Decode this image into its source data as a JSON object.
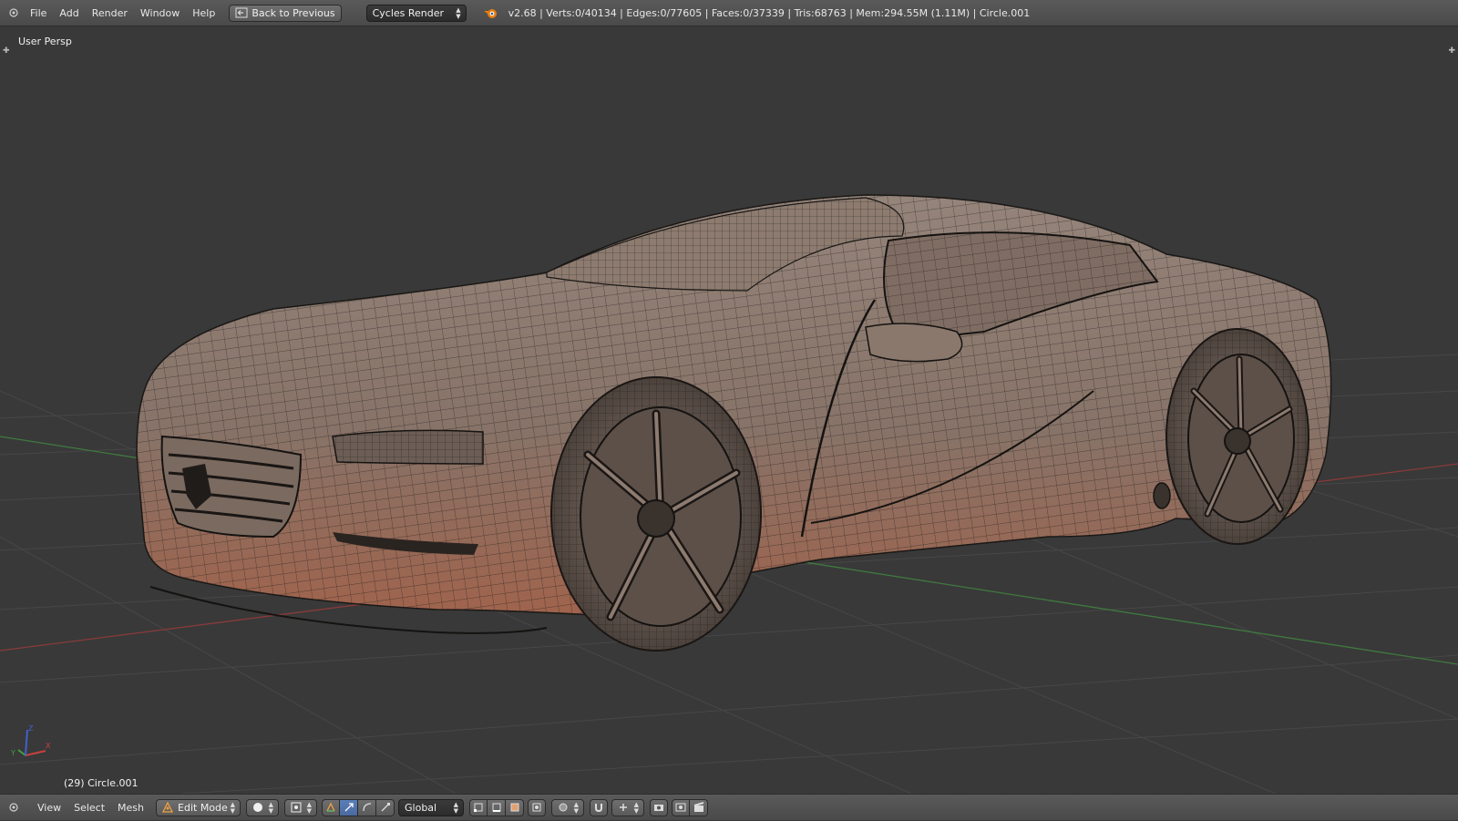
{
  "topbar": {
    "menus": [
      "File",
      "Add",
      "Render",
      "Window",
      "Help"
    ],
    "back_button": "Back to Previous",
    "render_engine": "Cycles Render",
    "stats": "v2.68 | Verts:0/40134 | Edges:0/77605 | Faces:0/37339 | Tris:68763 | Mem:294.55M (1.11M) | Circle.001"
  },
  "viewport": {
    "view_label": "User Persp",
    "object_label": "(29) Circle.001",
    "axis_labels": {
      "x": "X",
      "y": "Y",
      "z": "Z"
    }
  },
  "bottombar": {
    "menus": [
      "View",
      "Select",
      "Mesh"
    ],
    "mode": "Edit Mode",
    "orientation": "Global"
  },
  "colors": {
    "header_bg": "#4f4f4f",
    "viewport_bg": "#393939",
    "grid_line": "#4a4a4a",
    "x_axis": "#8a3a3a",
    "y_axis": "#3f7a3f",
    "mesh_fill": "#8a776c",
    "mesh_shadow": "#a0634c",
    "wire": "#1f1c1a",
    "active_blue": "#5a7fb8"
  }
}
